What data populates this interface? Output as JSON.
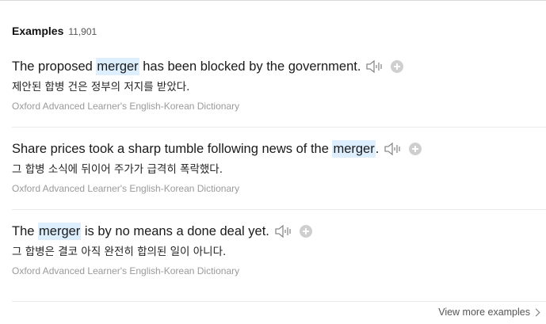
{
  "header": {
    "title": "Examples",
    "count": "11,901"
  },
  "examples": [
    {
      "before": "The proposed ",
      "highlight": "merger",
      "after": " has been blocked by the government.",
      "translation": "제안된 합병 건은 정부의 저지를 받았다.",
      "source": "Oxford Advanced Learner's English-Korean Dictionary"
    },
    {
      "before": "Share prices took a sharp tumble following news of the ",
      "highlight": "merger",
      "after": ".",
      "translation": "그 합병 소식에 뒤이어 주가가 급격히 폭락했다.",
      "source": "Oxford Advanced Learner's English-Korean Dictionary"
    },
    {
      "before": "The ",
      "highlight": "merger",
      "after": " is by no means a done deal yet.",
      "translation": "그 합병은 결코 아직 완전히 합의된 일이 아니다.",
      "source": "Oxford Advanced Learner's English-Korean Dictionary"
    }
  ],
  "icons": {
    "listen": "speaker-icon",
    "add": "plus-circle-icon",
    "more": "chevron-right-icon"
  },
  "footer": {
    "more_label": "View more examples"
  },
  "colors": {
    "highlight": "#ddeeff",
    "source_text": "#9a9a9a",
    "add_button": "#cfcfcf"
  }
}
